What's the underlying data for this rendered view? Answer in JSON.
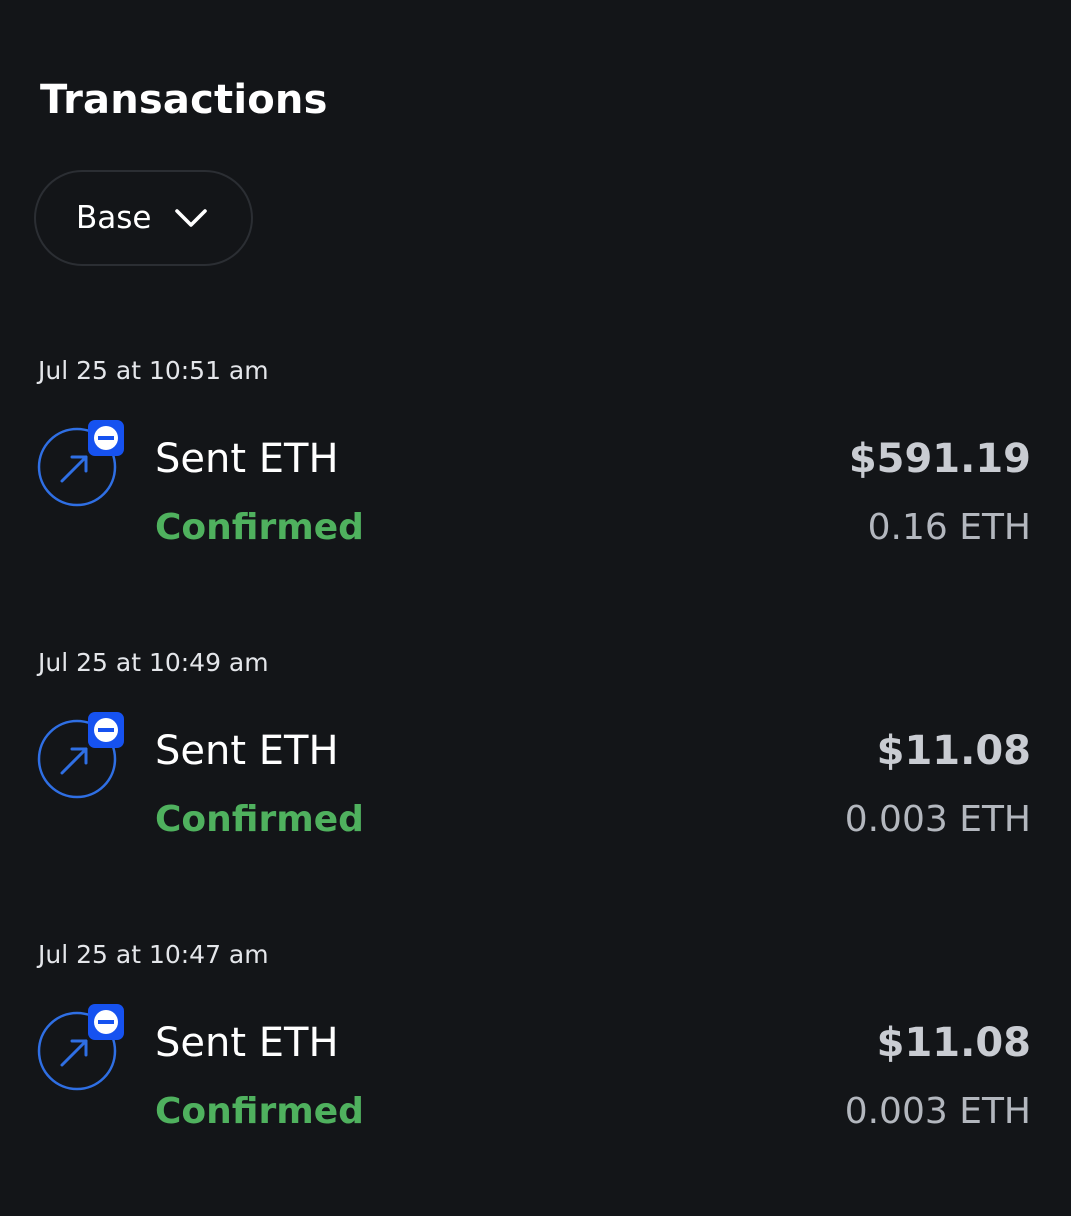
{
  "header": {
    "title": "Transactions"
  },
  "network_filter": {
    "selected": "Base",
    "icon": "chevron-down-icon"
  },
  "transactions": [
    {
      "date": "Jul 25 at 10:51 am",
      "title": "Sent ETH",
      "status": "Confirmed",
      "fiat_amount": "$591.19",
      "crypto_amount": "0.16 ETH",
      "icon": "send-arrow-icon",
      "badge_icon": "base-network-badge-icon"
    },
    {
      "date": "Jul 25 at 10:49 am",
      "title": "Sent ETH",
      "status": "Confirmed",
      "fiat_amount": "$11.08",
      "crypto_amount": "0.003 ETH",
      "icon": "send-arrow-icon",
      "badge_icon": "base-network-badge-icon"
    },
    {
      "date": "Jul 25 at 10:47 am",
      "title": "Sent ETH",
      "status": "Confirmed",
      "fiat_amount": "$11.08",
      "crypto_amount": "0.003 ETH",
      "icon": "send-arrow-icon",
      "badge_icon": "base-network-badge-icon"
    }
  ],
  "colors": {
    "background": "#131518",
    "status_confirmed": "#4fb15e",
    "accent_blue": "#2f6fe4",
    "badge_blue": "#1652f0"
  }
}
